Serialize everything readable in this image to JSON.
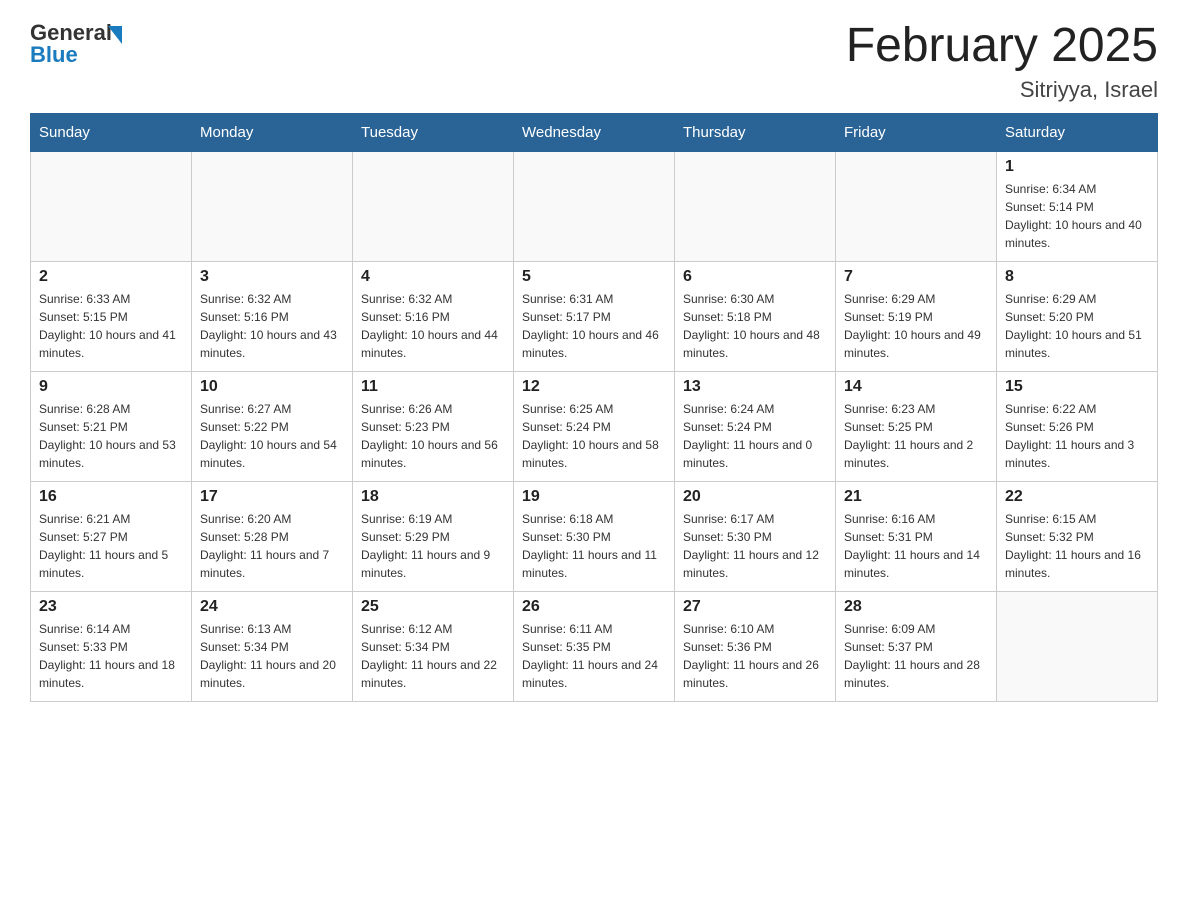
{
  "header": {
    "logo_general": "General",
    "logo_blue": "Blue",
    "main_title": "February 2025",
    "subtitle": "Sitriyya, Israel"
  },
  "days_of_week": [
    "Sunday",
    "Monday",
    "Tuesday",
    "Wednesday",
    "Thursday",
    "Friday",
    "Saturday"
  ],
  "weeks": [
    [
      {
        "day": "",
        "info": ""
      },
      {
        "day": "",
        "info": ""
      },
      {
        "day": "",
        "info": ""
      },
      {
        "day": "",
        "info": ""
      },
      {
        "day": "",
        "info": ""
      },
      {
        "day": "",
        "info": ""
      },
      {
        "day": "1",
        "info": "Sunrise: 6:34 AM\nSunset: 5:14 PM\nDaylight: 10 hours and 40 minutes."
      }
    ],
    [
      {
        "day": "2",
        "info": "Sunrise: 6:33 AM\nSunset: 5:15 PM\nDaylight: 10 hours and 41 minutes."
      },
      {
        "day": "3",
        "info": "Sunrise: 6:32 AM\nSunset: 5:16 PM\nDaylight: 10 hours and 43 minutes."
      },
      {
        "day": "4",
        "info": "Sunrise: 6:32 AM\nSunset: 5:16 PM\nDaylight: 10 hours and 44 minutes."
      },
      {
        "day": "5",
        "info": "Sunrise: 6:31 AM\nSunset: 5:17 PM\nDaylight: 10 hours and 46 minutes."
      },
      {
        "day": "6",
        "info": "Sunrise: 6:30 AM\nSunset: 5:18 PM\nDaylight: 10 hours and 48 minutes."
      },
      {
        "day": "7",
        "info": "Sunrise: 6:29 AM\nSunset: 5:19 PM\nDaylight: 10 hours and 49 minutes."
      },
      {
        "day": "8",
        "info": "Sunrise: 6:29 AM\nSunset: 5:20 PM\nDaylight: 10 hours and 51 minutes."
      }
    ],
    [
      {
        "day": "9",
        "info": "Sunrise: 6:28 AM\nSunset: 5:21 PM\nDaylight: 10 hours and 53 minutes."
      },
      {
        "day": "10",
        "info": "Sunrise: 6:27 AM\nSunset: 5:22 PM\nDaylight: 10 hours and 54 minutes."
      },
      {
        "day": "11",
        "info": "Sunrise: 6:26 AM\nSunset: 5:23 PM\nDaylight: 10 hours and 56 minutes."
      },
      {
        "day": "12",
        "info": "Sunrise: 6:25 AM\nSunset: 5:24 PM\nDaylight: 10 hours and 58 minutes."
      },
      {
        "day": "13",
        "info": "Sunrise: 6:24 AM\nSunset: 5:24 PM\nDaylight: 11 hours and 0 minutes."
      },
      {
        "day": "14",
        "info": "Sunrise: 6:23 AM\nSunset: 5:25 PM\nDaylight: 11 hours and 2 minutes."
      },
      {
        "day": "15",
        "info": "Sunrise: 6:22 AM\nSunset: 5:26 PM\nDaylight: 11 hours and 3 minutes."
      }
    ],
    [
      {
        "day": "16",
        "info": "Sunrise: 6:21 AM\nSunset: 5:27 PM\nDaylight: 11 hours and 5 minutes."
      },
      {
        "day": "17",
        "info": "Sunrise: 6:20 AM\nSunset: 5:28 PM\nDaylight: 11 hours and 7 minutes."
      },
      {
        "day": "18",
        "info": "Sunrise: 6:19 AM\nSunset: 5:29 PM\nDaylight: 11 hours and 9 minutes."
      },
      {
        "day": "19",
        "info": "Sunrise: 6:18 AM\nSunset: 5:30 PM\nDaylight: 11 hours and 11 minutes."
      },
      {
        "day": "20",
        "info": "Sunrise: 6:17 AM\nSunset: 5:30 PM\nDaylight: 11 hours and 12 minutes."
      },
      {
        "day": "21",
        "info": "Sunrise: 6:16 AM\nSunset: 5:31 PM\nDaylight: 11 hours and 14 minutes."
      },
      {
        "day": "22",
        "info": "Sunrise: 6:15 AM\nSunset: 5:32 PM\nDaylight: 11 hours and 16 minutes."
      }
    ],
    [
      {
        "day": "23",
        "info": "Sunrise: 6:14 AM\nSunset: 5:33 PM\nDaylight: 11 hours and 18 minutes."
      },
      {
        "day": "24",
        "info": "Sunrise: 6:13 AM\nSunset: 5:34 PM\nDaylight: 11 hours and 20 minutes."
      },
      {
        "day": "25",
        "info": "Sunrise: 6:12 AM\nSunset: 5:34 PM\nDaylight: 11 hours and 22 minutes."
      },
      {
        "day": "26",
        "info": "Sunrise: 6:11 AM\nSunset: 5:35 PM\nDaylight: 11 hours and 24 minutes."
      },
      {
        "day": "27",
        "info": "Sunrise: 6:10 AM\nSunset: 5:36 PM\nDaylight: 11 hours and 26 minutes."
      },
      {
        "day": "28",
        "info": "Sunrise: 6:09 AM\nSunset: 5:37 PM\nDaylight: 11 hours and 28 minutes."
      },
      {
        "day": "",
        "info": ""
      }
    ]
  ]
}
